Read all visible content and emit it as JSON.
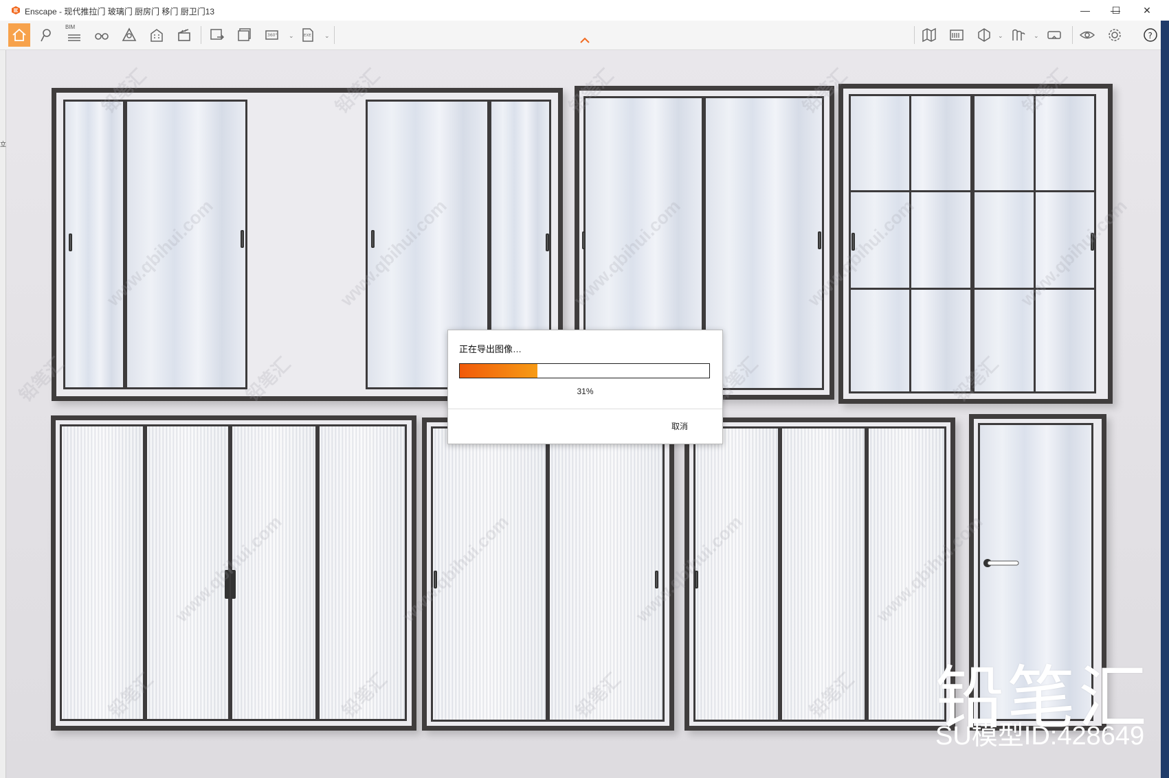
{
  "window": {
    "title": "Enscape - 现代推拉门 玻璃门 厨房门 移门 厨卫门13",
    "accent_color": "#f7a24b"
  },
  "title_controls": {
    "minimize": "—",
    "maximize": "☐",
    "close": "✕"
  },
  "toolbar": {
    "bim_label": "BIM",
    "icons": [
      "home-icon",
      "location-pin-icon",
      "bim-list-icon",
      "binoculars-icon",
      "atmosphere-icon",
      "building-icon",
      "clapper-icon",
      "export-image-icon",
      "batch-render-icon",
      "panorama-360-icon",
      "export-exe-icon",
      "map-icon",
      "asset-library-icon",
      "cube-view-icon",
      "material-icon",
      "vr-headset-icon",
      "visibility-eye-icon",
      "settings-gear-icon",
      "help-icon"
    ]
  },
  "sidebar": {
    "fragment_text": "立"
  },
  "scene": {
    "watermark_cn": "铅笔汇",
    "watermark_url": "www.qbihui.com",
    "brand_big": "铅笔汇",
    "brand_id": "SU模型ID:428649"
  },
  "dialog": {
    "title": "正在导出图像…",
    "progress": 0.31,
    "percent_label": "31%",
    "cancel_label": "取消",
    "fill_start": "#f15a0a",
    "fill_end": "#f79b15"
  }
}
